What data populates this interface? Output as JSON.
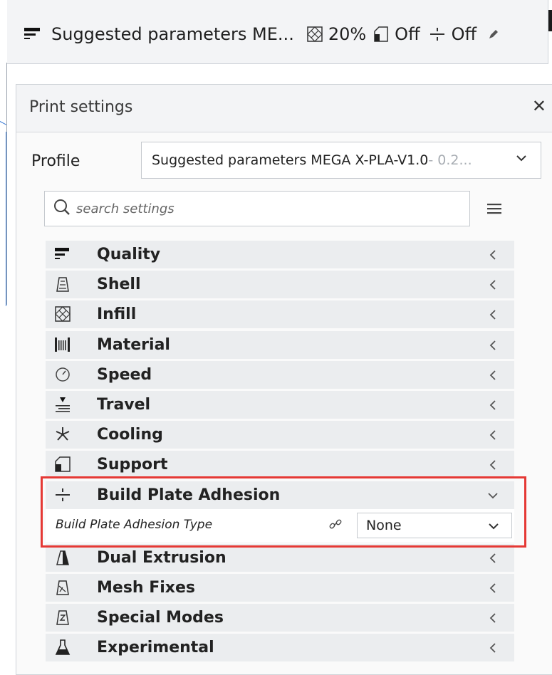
{
  "topbar": {
    "profile_name": "Suggested parameters ME...",
    "infill_value": "20%",
    "support_value": "Off",
    "adhesion_value": "Off",
    "icons": [
      "quality-icon",
      "infill-icon",
      "support-icon",
      "adhesion-icon",
      "pencil-icon"
    ]
  },
  "panel": {
    "title": "Print settings",
    "close_label": "✕"
  },
  "profile": {
    "label": "Profile",
    "selected": "Suggested parameters MEGA X-PLA-V1.0",
    "selected_suffix": " - 0.2..."
  },
  "search": {
    "placeholder": "search settings"
  },
  "categories": [
    {
      "label": "Quality",
      "icon": "quality-icon"
    },
    {
      "label": "Shell",
      "icon": "shell-icon"
    },
    {
      "label": "Infill",
      "icon": "infill-icon"
    },
    {
      "label": "Material",
      "icon": "material-icon"
    },
    {
      "label": "Speed",
      "icon": "speed-icon"
    },
    {
      "label": "Travel",
      "icon": "travel-icon"
    },
    {
      "label": "Cooling",
      "icon": "cooling-icon"
    },
    {
      "label": "Support",
      "icon": "support-icon"
    },
    {
      "label": "Build Plate Adhesion",
      "icon": "adhesion-icon",
      "expanded": true
    },
    {
      "label": "Dual Extrusion",
      "icon": "dual-extrusion-icon"
    },
    {
      "label": "Mesh Fixes",
      "icon": "mesh-fixes-icon"
    },
    {
      "label": "Special Modes",
      "icon": "special-modes-icon"
    },
    {
      "label": "Experimental",
      "icon": "experimental-icon"
    }
  ],
  "setting": {
    "label": "Build Plate Adhesion Type",
    "value": "None"
  },
  "colors": {
    "highlight": "#e53935",
    "category_bg": "#ebedef",
    "panel_bg": "#fafafa"
  }
}
